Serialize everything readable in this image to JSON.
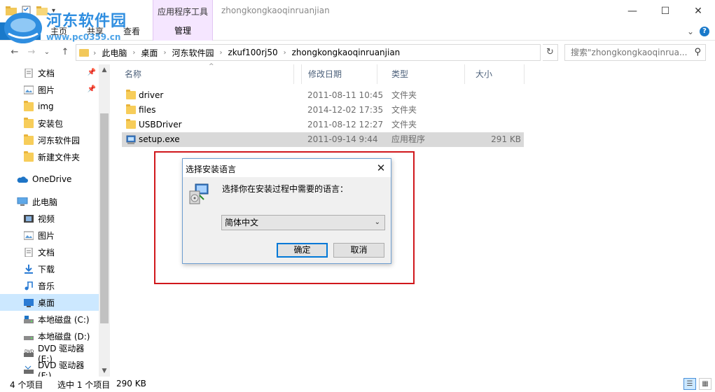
{
  "window": {
    "title": "zhongkongkaoqinruanjian",
    "contextual_tab_group": "应用程序工具",
    "minimize_glyph": "—",
    "maximize_glyph": "☐",
    "close_glyph": "✕"
  },
  "ribbon": {
    "tabs": [
      "文件",
      "主页",
      "共享",
      "查看"
    ],
    "contextual_tab": "管理",
    "expand_glyph": "⌄",
    "help_glyph": "?"
  },
  "address": {
    "crumbs": [
      "此电脑",
      "桌面",
      "河东软件园",
      "zkuf100rj50",
      "zhongkongkaoqinruanjian"
    ],
    "search_placeholder": "搜索\"zhongkongkaoqinrua...",
    "back_glyph": "←",
    "forward_glyph": "→",
    "recent_glyph": "⌄",
    "up_glyph": "↑",
    "sep_glyph": "›",
    "dropdown_glyph": "⌄",
    "refresh_glyph": "↻",
    "search_glyph": "⚲"
  },
  "navigation": {
    "quick_access": [
      {
        "label": "文档",
        "icon": "document-icon",
        "pinned": true
      },
      {
        "label": "图片",
        "icon": "pictures-icon",
        "pinned": true
      },
      {
        "label": "img",
        "icon": "folder-icon",
        "pinned": false
      },
      {
        "label": "安装包",
        "icon": "folder-icon",
        "pinned": false
      },
      {
        "label": "河东软件园",
        "icon": "folder-icon",
        "pinned": false
      },
      {
        "label": "新建文件夹",
        "icon": "folder-icon",
        "pinned": false
      }
    ],
    "onedrive": "OneDrive",
    "this_pc": "此电脑",
    "pc_items": [
      {
        "label": "视频",
        "icon": "video-icon"
      },
      {
        "label": "图片",
        "icon": "pictures-icon"
      },
      {
        "label": "文档",
        "icon": "document-icon"
      },
      {
        "label": "下载",
        "icon": "download-icon"
      },
      {
        "label": "音乐",
        "icon": "music-icon"
      },
      {
        "label": "桌面",
        "icon": "desktop-icon",
        "selected": true
      },
      {
        "label": "本地磁盘 (C:)",
        "icon": "drive-icon"
      },
      {
        "label": "本地磁盘 (D:)",
        "icon": "drive-icon"
      },
      {
        "label": "DVD 驱动器 (E:)",
        "icon": "dvd-icon"
      },
      {
        "label": "DVD 驱动器 (F:)",
        "icon": "dvd-icon"
      }
    ],
    "pin_glyph": "📌",
    "scroll_up_glyph": "▲",
    "scroll_down_glyph": "▼"
  },
  "files": {
    "columns": [
      "名称",
      "修改日期",
      "类型",
      "大小"
    ],
    "sort_glyph": "^",
    "rows": [
      {
        "name": "driver",
        "date": "2011-08-11 10:45",
        "type": "文件夹",
        "size": "",
        "icon": "folder-icon"
      },
      {
        "name": "files",
        "date": "2014-12-02 17:35",
        "type": "文件夹",
        "size": "",
        "icon": "folder-icon"
      },
      {
        "name": "USBDriver",
        "date": "2011-08-12 12:27",
        "type": "文件夹",
        "size": "",
        "icon": "folder-icon"
      },
      {
        "name": "setup.exe",
        "date": "2011-09-14 9:44",
        "type": "应用程序",
        "size": "291 KB",
        "icon": "installer-icon",
        "selected": true
      }
    ]
  },
  "dialog": {
    "title": "选择安装语言",
    "prompt": "选择你在安装过程中需要的语言：",
    "selected_language": "简体中文",
    "ok_label": "确定",
    "cancel_label": "取消",
    "close_glyph": "✕",
    "dropdown_glyph": "⌄"
  },
  "status": {
    "item_count": "4 个项目",
    "selection": "选中 1 个项目",
    "selection_size": "290 KB",
    "details_view_glyph": "☰",
    "icons_view_glyph": "▦"
  },
  "watermark": {
    "text": "河东软件园",
    "url": "www.pc0359.cn"
  },
  "colors": {
    "accent": "#1979ca",
    "selection": "#cce8ff",
    "highlight_box": "#d0171c",
    "contextual_tab": "#f5e6ff"
  }
}
